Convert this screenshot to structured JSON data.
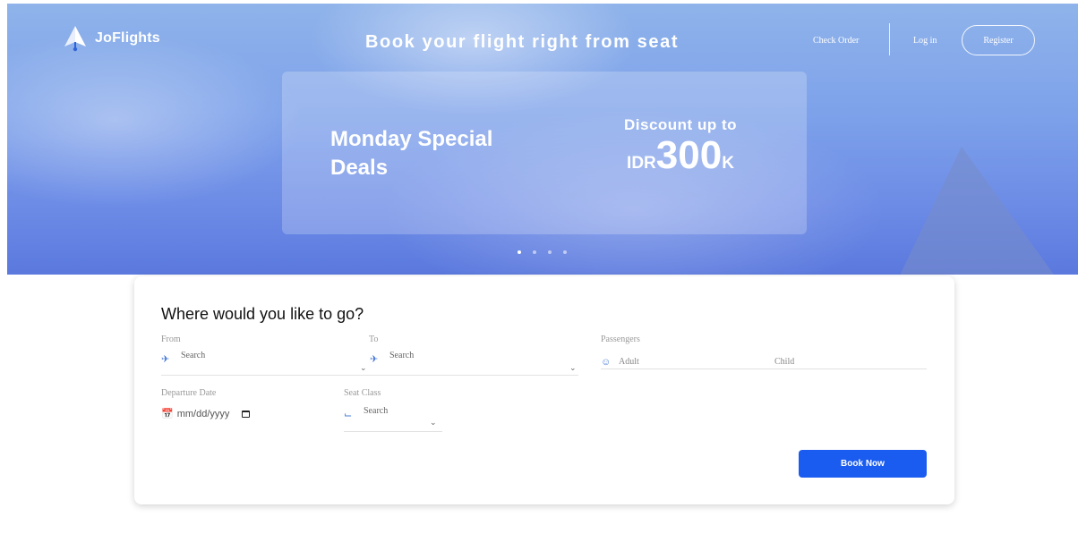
{
  "brand": {
    "name": "JoFlights",
    "logo_icon": "paper-plane-icon"
  },
  "hero": {
    "title": "Book your flight right from seat",
    "nav": {
      "check_order": "Check Order",
      "login": "Log in",
      "register": "Register"
    },
    "promo": {
      "headline": "Monday Special Deals",
      "discount_label": "Discount up to",
      "currency": "IDR",
      "amount": "300",
      "unit": "K"
    },
    "carousel": {
      "slides": 4,
      "active": 1
    }
  },
  "search": {
    "title": "Where would you like to go?",
    "from": {
      "label": "From",
      "placeholder": "Search",
      "icon": "takeoff-icon"
    },
    "to": {
      "label": "To",
      "placeholder": "Search",
      "icon": "landing-icon"
    },
    "passengers": {
      "label": "Passengers",
      "adult": "Adult",
      "child": "Child",
      "icon": "people-icon"
    },
    "departure": {
      "label": "Departure Date",
      "placeholder": "mm/dd/yyyy",
      "icon": "calendar-icon"
    },
    "seat_class": {
      "label": "Seat Class",
      "placeholder": "Search",
      "icon": "seat-icon"
    },
    "submit": "Book Now"
  },
  "colors": {
    "primary": "#1a5cf0",
    "hero_top": "#8fb3ea",
    "hero_bottom": "#5b79de",
    "icon": "#4a7bd6"
  }
}
